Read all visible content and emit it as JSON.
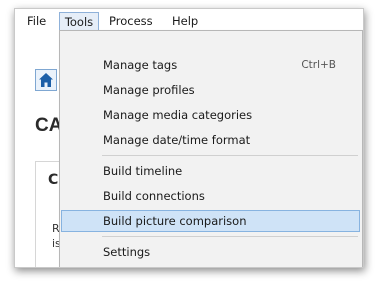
{
  "menubar": {
    "items": [
      "File",
      "Tools",
      "Process",
      "Help"
    ]
  },
  "background": {
    "title_fragment": "CA",
    "panel_heading_fragment": "C",
    "panel_text_fragments": [
      "R",
      "is"
    ]
  },
  "tools_menu": {
    "groups": [
      [
        {
          "label": "Manage tags",
          "shortcut": "Ctrl+B"
        },
        {
          "label": "Manage profiles",
          "shortcut": ""
        },
        {
          "label": "Manage media categories",
          "shortcut": ""
        },
        {
          "label": "Manage date/time format",
          "shortcut": ""
        }
      ],
      [
        {
          "label": "Build timeline",
          "shortcut": ""
        },
        {
          "label": "Build connections",
          "shortcut": ""
        },
        {
          "label": "Build picture comparison",
          "shortcut": "",
          "highlighted": true
        }
      ],
      [
        {
          "label": "Settings",
          "shortcut": ""
        }
      ]
    ]
  },
  "colors": {
    "highlight_fill": "#cfe3f7",
    "highlight_border": "#87b3e0",
    "menu_background": "#f2f2f2",
    "home_icon": "#1c5fa8"
  }
}
